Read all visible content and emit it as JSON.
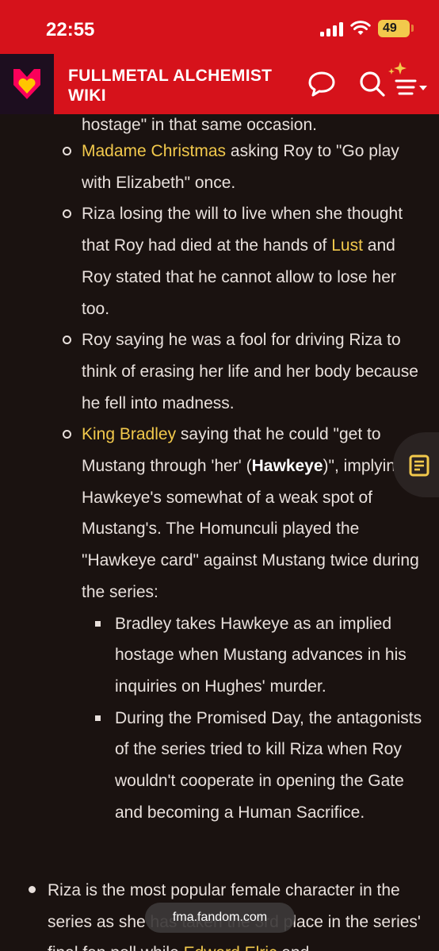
{
  "status_bar": {
    "time": "22:55",
    "battery": "49"
  },
  "header": {
    "title": "FULLMETAL ALCHEMIST WIKI",
    "brand_color": "#d6121b",
    "link_color": "#f2c94c"
  },
  "content": {
    "cut_line": "hostage\" in that same occasion.",
    "items": [
      {
        "link": "Madame Christmas",
        "text": " asking Roy to \"Go play with Elizabeth\" once."
      },
      {
        "text_a": "Riza losing the will to live when she thought that Roy had died at the hands of ",
        "link": "Lust",
        "text_b": " and Roy stated that he cannot allow to lose her too."
      },
      {
        "text": "Roy saying he was a fool for driving Riza to think of erasing her life and her body because he fell into madness."
      },
      {
        "link": "King Bradley",
        "text_a": " saying that he could \"get to Mustang through 'her' (",
        "bold": "Hawkeye",
        "text_b": ")\", implying Hawkeye's somewhat of a weak spot of Mustang's. The Homunculi played the \"Hawkeye card\" against Mustang twice during the series:",
        "subitems": [
          "Bradley takes Hawkeye as an implied hostage when Mustang advances in his inquiries on Hughes' murder.",
          "During the Promised Day, the antagonists of the series tried to kill Riza when Roy wouldn't cooperate in opening the Gate and becoming a Human Sacrifice."
        ]
      }
    ],
    "top_item": {
      "text_a": "Riza is the most popular female character in the series as she has taken the 3rd place in the series' final fan poll while ",
      "link": "Edward Elric",
      "text_b": " and"
    }
  },
  "url_bar": {
    "url": "fma.fandom.com"
  },
  "icons": {
    "logo": "fandom-heart-icon",
    "chat": "chat-bubble-icon",
    "search": "search-icon",
    "menu": "sparkle-menu-icon",
    "toc": "table-of-contents-icon"
  }
}
